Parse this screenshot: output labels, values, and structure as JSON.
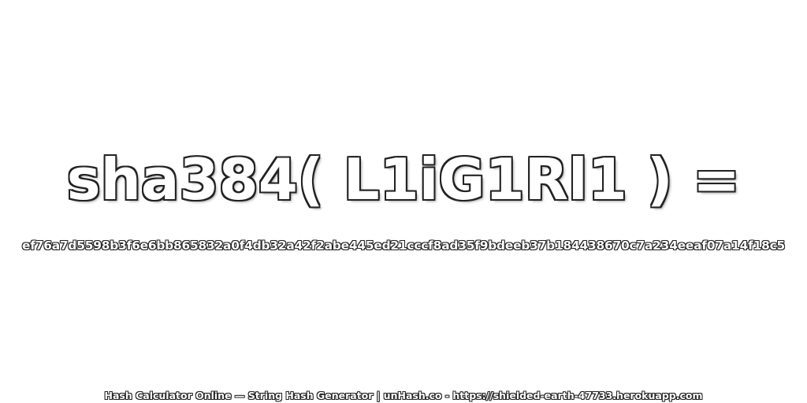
{
  "heading": {
    "expression": "sha384( L1iG1Rl1 ) ="
  },
  "result": {
    "hash": "ef76a7d5598b3f6e6bb865832a0f4db32a42f2abe445ed21cccf8ad35f9bdeeb37b184438670c7a234eeaf07a14f18c5"
  },
  "footer": {
    "text": "Hash Calculator Online — String Hash Generator | unHash.co - https://shielded-earth-47733.herokuapp.com"
  }
}
